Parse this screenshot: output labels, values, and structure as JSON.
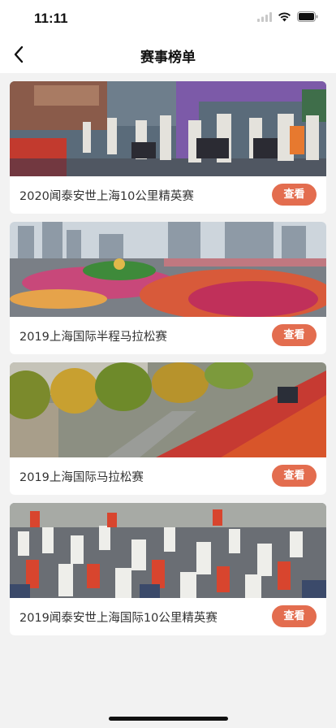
{
  "status_bar": {
    "time": "11:11"
  },
  "nav": {
    "title": "赛事榜单"
  },
  "races": [
    {
      "title": "2020闻泰安世上海10公里精英赛",
      "button_label": "查看"
    },
    {
      "title": "2019上海国际半程马拉松赛",
      "button_label": "查看"
    },
    {
      "title": "2019上海国际马拉松赛",
      "button_label": "查看"
    },
    {
      "title": "2019闻泰安世上海国际10公里精英赛",
      "button_label": "查看"
    }
  ],
  "colors": {
    "accent": "#e36d4f",
    "background": "#f2f2f2"
  },
  "icons": [
    "signal-icon",
    "wifi-icon",
    "battery-icon",
    "back-arrow-icon"
  ]
}
